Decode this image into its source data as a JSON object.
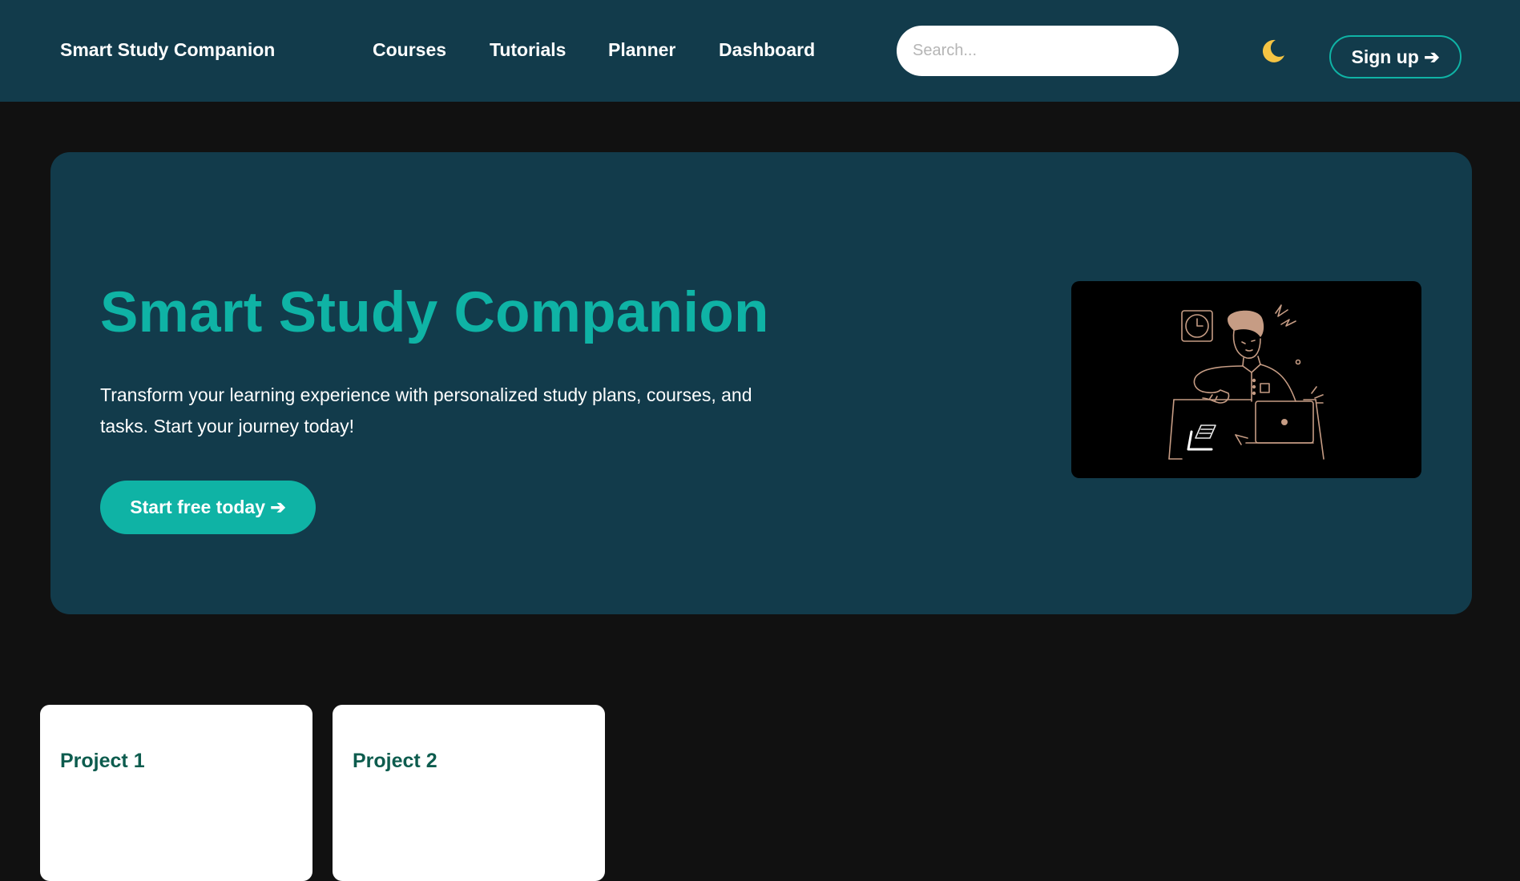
{
  "header": {
    "brand": "Smart Study Companion",
    "nav": [
      {
        "label": "Courses"
      },
      {
        "label": "Tutorials"
      },
      {
        "label": "Planner"
      },
      {
        "label": "Dashboard"
      }
    ],
    "search_placeholder": "Search...",
    "theme_toggle_icon": "moon-icon",
    "signup_label": "Sign up ➔"
  },
  "hero": {
    "title": "Smart Study Companion",
    "description": "Transform your learning experience with personalized study plans, courses, and tasks. Start your journey today!",
    "cta_label": "Start free today ➔",
    "illustration_icon": "student-at-desk-illustration"
  },
  "projects": [
    {
      "title": "Project 1"
    },
    {
      "title": "Project 2"
    }
  ],
  "colors": {
    "header_bg": "#123b4b",
    "page_bg": "#111111",
    "accent": "#0fb3a5",
    "card_title": "#0d5c4e",
    "moon": "#f5c443",
    "illustration_line": "#c69c84"
  }
}
